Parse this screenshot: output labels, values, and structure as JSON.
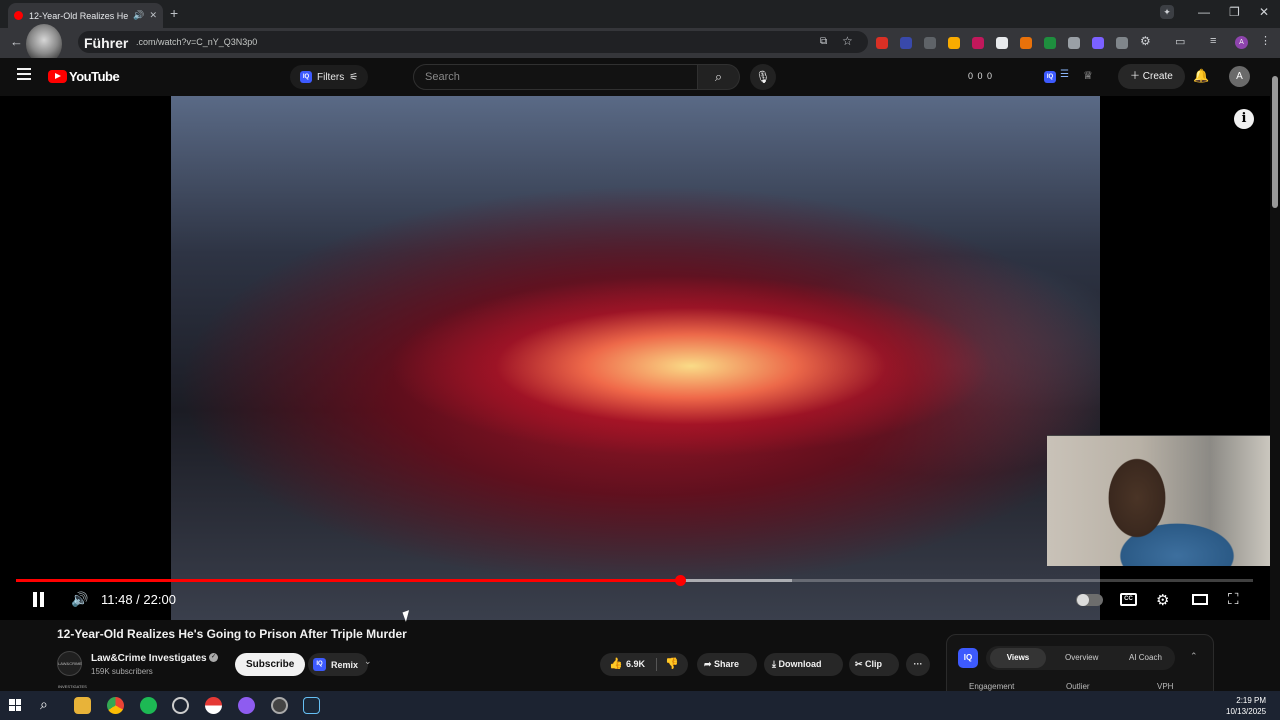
{
  "browser": {
    "tab_title": "12-Year-Old Realizes He's G",
    "tab_icons": [
      "speaker-icon",
      "close-icon"
    ],
    "new_tab_label": "+",
    "url": ".com/watch?v=C_nY_Q3N3p0",
    "overlay_label": "Führer",
    "window_controls": [
      "—",
      "❐",
      "✕"
    ],
    "accent": "#ff0000"
  },
  "youtube": {
    "logo_text": "YouTube",
    "filters_label": "Filters",
    "search_placeholder": "Search",
    "stats": "0 0 0",
    "create_label": "Create",
    "account_initial": "A"
  },
  "player": {
    "time": "11:48 / 22:00",
    "progress": 0.537,
    "buffered": 0.627
  },
  "video": {
    "title": "12-Year-Old Realizes He's Going to Prison After Triple Murder",
    "channel_name": "Law&Crime Investigates",
    "channel_avatar_text": "LAW&CRIME INVESTIGATES",
    "subscribers": "159K subscribers",
    "subscribe_label": "Subscribe",
    "remix_label": "Remix",
    "like_count": "6.9K",
    "share_label": "Share",
    "download_label": "Download",
    "clip_label": "Clip",
    "more_label": "···"
  },
  "iq_panel": {
    "logo_text": "IQ",
    "tabs": [
      "Views",
      "Overview",
      "AI Coach"
    ],
    "columns": [
      "Engagement",
      "Outlier",
      "VPH"
    ]
  },
  "taskbar": {
    "time": "2:19 PM",
    "date": "10/13/2025"
  }
}
